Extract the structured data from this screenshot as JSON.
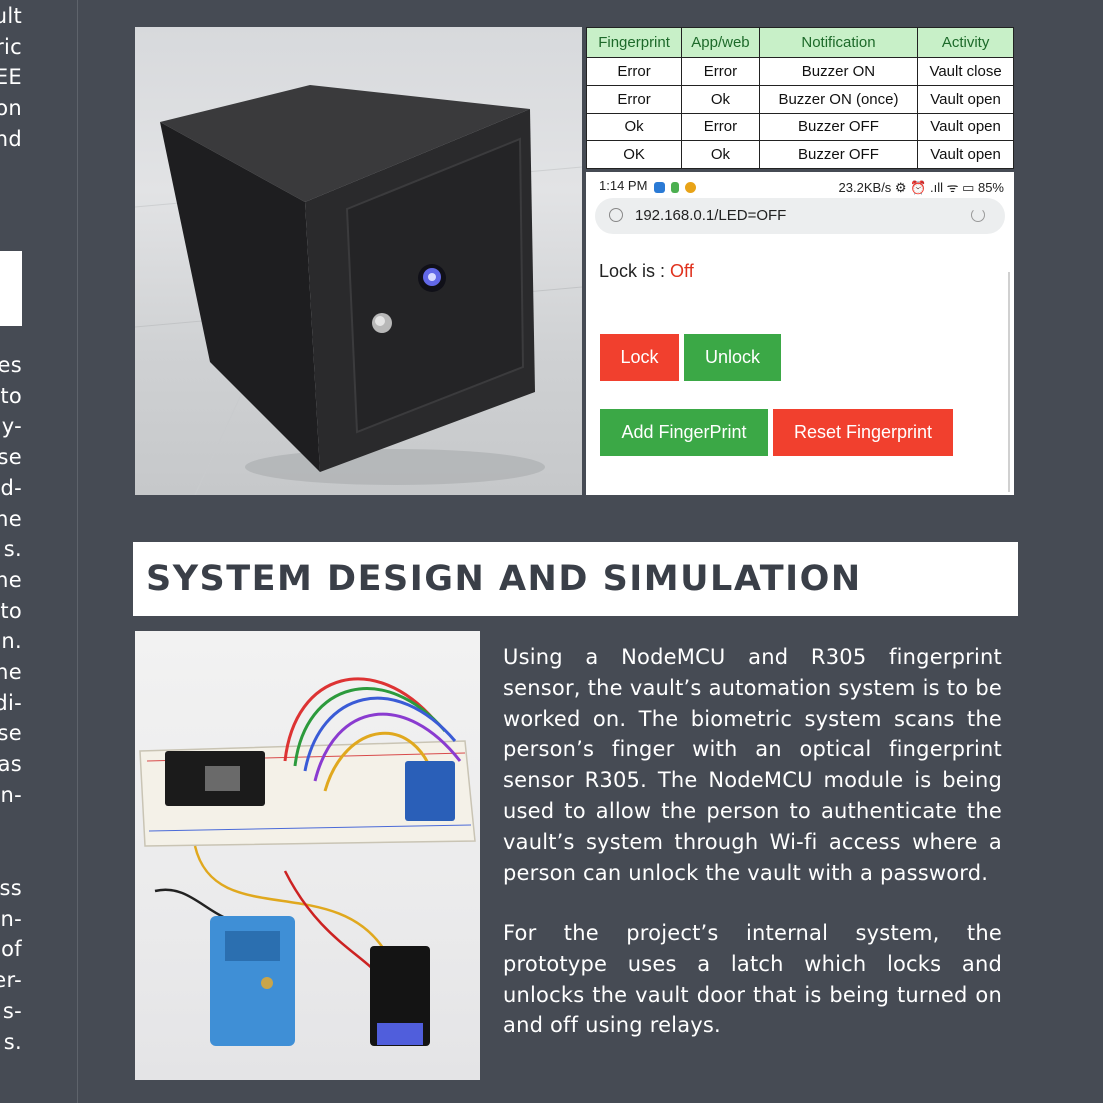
{
  "left_column": {
    "lines_top": [
      "ult",
      "ric",
      "EE",
      "on",
      "nd"
    ],
    "lines_mid": [
      "es",
      "to",
      "y-",
      "se",
      "d-",
      "he",
      "s.",
      "he",
      "to",
      "n.",
      "he",
      "di-",
      "se",
      "as",
      "n-"
    ],
    "lines_bottom": [
      "ss",
      "n-",
      "of",
      "er-",
      "s-",
      "s."
    ]
  },
  "truth_table": {
    "headers": [
      "Fingerprint",
      "App/web",
      "Notification",
      "Activity"
    ],
    "rows": [
      [
        "Error",
        "Error",
        "Buzzer ON",
        "Vault close"
      ],
      [
        "Error",
        "Ok",
        "Buzzer ON (once)",
        "Vault open"
      ],
      [
        "Ok",
        "Error",
        "Buzzer OFF",
        "Vault open"
      ],
      [
        "OK",
        "Ok",
        "Buzzer OFF",
        "Vault open"
      ]
    ],
    "header_color": "#c8f0c8"
  },
  "phone": {
    "status_time": "1:14 PM",
    "status_right": "23.2KB/s ⚙ ⏰ .ıll ᯤ ▭ 85%",
    "url": "192.168.0.1/LED=OFF",
    "lock_label": "Lock is : ",
    "lock_value": "Off",
    "buttons": {
      "lock": "Lock",
      "unlock": "Unlock",
      "add_fingerprint": "Add FingerPrint",
      "reset_fingerprint": "Reset Fingerprint"
    },
    "colors": {
      "red": "#f1402e",
      "green": "#3ba846"
    }
  },
  "section": {
    "heading": "SYSTEM DESIGN AND SIMULATION"
  },
  "body": {
    "paragraph1": "Using a NodeMCU and R305 fingerprint sensor, the vault’s automation system is to be worked on. The biometric system scans the person’s finger with an optical fingerprint sensor R305. The NodeMCU module is being used to allow the person to authenticate the vault’s system through Wi-fi access where a person can unlock the vault with a password.",
    "paragraph2": "For the project’s internal system, the prototype uses a latch which locks and unlocks the vault door that is being turned on and off using relays."
  },
  "images": {
    "vault_photo": "vault-box-photo",
    "circuit_photo": "circuit-breadboard-photo"
  },
  "theme": {
    "background": "#464b54",
    "heading_text": "#3a3f48"
  }
}
